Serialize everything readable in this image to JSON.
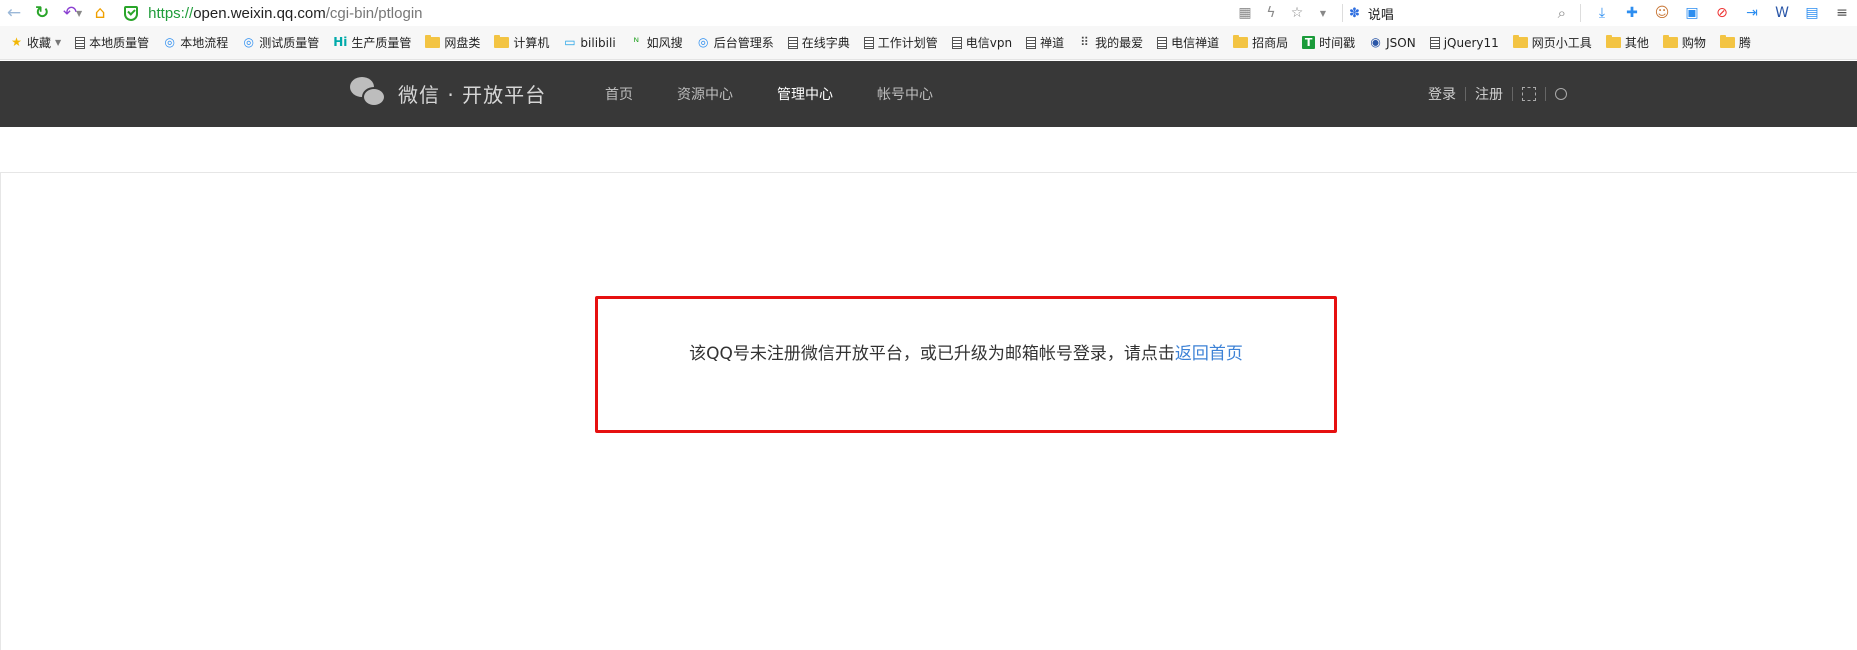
{
  "browser": {
    "url_protocol": "https://",
    "url_host": "open.weixin.qq.com",
    "url_path": "/cgi-bin/ptlogin",
    "search_text": "说唱"
  },
  "bookmarks": [
    {
      "label": "收藏",
      "icon": "star-icon"
    },
    {
      "label": "本地质量管",
      "icon": "doc-icon"
    },
    {
      "label": "本地流程",
      "icon": "globe-icon"
    },
    {
      "label": "测试质量管",
      "icon": "globe-icon"
    },
    {
      "label": "生产质量管",
      "icon": "hi-icon",
      "prefix": "Hi"
    },
    {
      "label": "网盘类",
      "icon": "folder-icon"
    },
    {
      "label": "计算机",
      "icon": "folder-icon"
    },
    {
      "label": "bilibili",
      "icon": "tv-icon"
    },
    {
      "label": "如风搜",
      "icon": "feng-icon"
    },
    {
      "label": "后台管理系",
      "icon": "globe-icon"
    },
    {
      "label": "在线字典",
      "icon": "doc-icon"
    },
    {
      "label": "工作计划管",
      "icon": "doc-icon"
    },
    {
      "label": "电信vpn",
      "icon": "doc-icon"
    },
    {
      "label": "禅道",
      "icon": "doc-icon"
    },
    {
      "label": "我的最爱",
      "icon": "grid-icon"
    },
    {
      "label": "电信禅道",
      "icon": "doc-icon"
    },
    {
      "label": "招商局",
      "icon": "folder-icon"
    },
    {
      "label": "时间戳",
      "icon": "t-icon",
      "prefix": "T"
    },
    {
      "label": "JSON",
      "icon": "json-icon"
    },
    {
      "label": "jQuery11",
      "icon": "doc-icon"
    },
    {
      "label": "网页小工具",
      "icon": "folder-icon"
    },
    {
      "label": "其他",
      "icon": "folder-icon"
    },
    {
      "label": "购物",
      "icon": "folder-icon"
    },
    {
      "label": "腾",
      "icon": "folder-icon"
    }
  ],
  "site": {
    "logo_text": "微信 · 开放平台",
    "nav": [
      "首页",
      "资源中心",
      "管理中心",
      "帐号中心"
    ],
    "active_nav": "管理中心",
    "login": "登录",
    "register": "注册"
  },
  "message": {
    "text": "该QQ号未注册微信开放平台，或已升级为邮箱帐号登录，请点击",
    "link": "返回首页"
  },
  "colors": {
    "header_bg": "#383838",
    "highlight_border": "#e61010",
    "link": "#3d82d6"
  }
}
